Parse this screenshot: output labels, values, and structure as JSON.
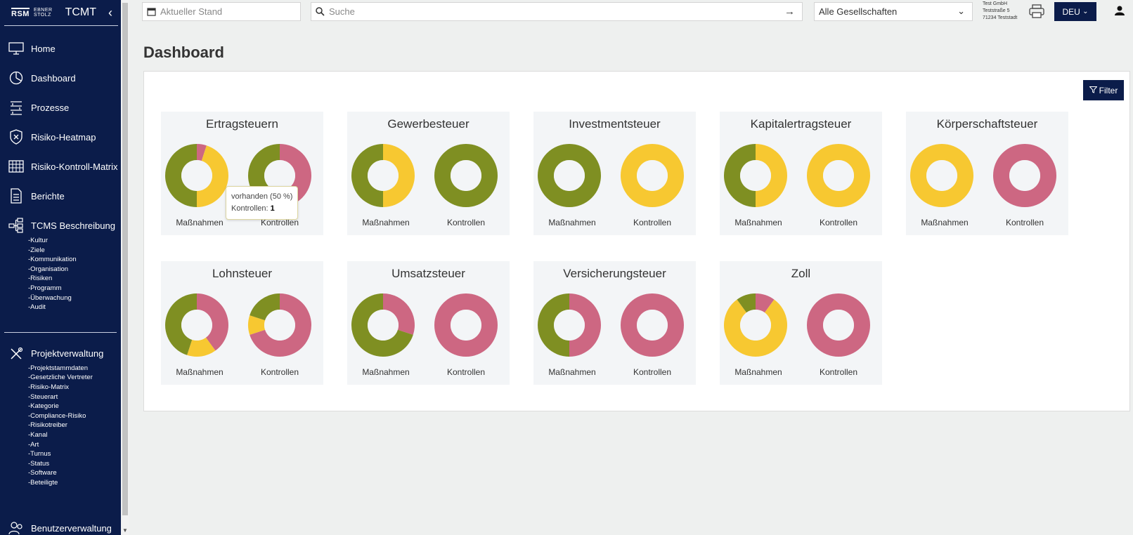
{
  "app": {
    "logo_main": "RSM",
    "logo_line1": "EBNER",
    "logo_line2": "STOLZ",
    "name": "TCMT"
  },
  "sidebar": {
    "items": [
      {
        "label": "Home",
        "icon": "monitor-icon"
      },
      {
        "label": "Dashboard",
        "icon": "pie-chart-icon"
      },
      {
        "label": "Prozesse",
        "icon": "process-icon"
      },
      {
        "label": "Risiko-Heatmap",
        "icon": "shield-icon"
      },
      {
        "label": "Risiko-Kontroll-Matrix",
        "icon": "grid-icon"
      },
      {
        "label": "Berichte",
        "icon": "report-icon"
      },
      {
        "label": "TCMS Beschreibung",
        "icon": "hierarchy-icon"
      }
    ],
    "tcms_subs": [
      "-Kultur",
      "-Ziele",
      "-Kommunikation",
      "-Organisation",
      "-Risiken",
      "-Programm",
      "-Überwachung",
      "-Audit"
    ],
    "projekt": {
      "label": "Projektverwaltung",
      "icon": "tools-icon"
    },
    "projekt_subs": [
      "-Projektstammdaten",
      "-Gesetzliche Vertreter",
      "-Risiko-Matrix",
      "-Steuerart",
      "-Kategorie",
      "-Compliance-Risiko",
      "-Risikotreiber",
      "-Kanal",
      "-Art",
      "-Turnus",
      "-Status",
      "-Software",
      "-Beteiligte"
    ],
    "benutzer": {
      "label": "Benutzerverwaltung",
      "icon": "users-icon"
    }
  },
  "topbar": {
    "date_placeholder": "Aktueller Stand",
    "search_placeholder": "Suche",
    "company_select": "Alle Gesellschaften",
    "company_lines": [
      "Test GmbH",
      "Teststraße 5",
      "71234 Teststadt"
    ],
    "language": "DEU"
  },
  "page": {
    "title": "Dashboard",
    "filter_label": "Filter"
  },
  "colors": {
    "green": "#7f8f22",
    "yellow": "#f7c831",
    "pink": "#cd6782",
    "navy": "#0b1c4a"
  },
  "chart_data": {
    "type": "pie",
    "donut_labels": [
      "Maßnahmen",
      "Kontrollen"
    ],
    "cards": [
      {
        "title": "Ertragsteuern",
        "massnahmen": {
          "green": 50,
          "yellow": 45,
          "pink": 5
        },
        "kontrollen": {
          "green": 50,
          "yellow": 0,
          "pink": 50
        }
      },
      {
        "title": "Gewerbesteuer",
        "massnahmen": {
          "green": 50,
          "yellow": 50,
          "pink": 0
        },
        "kontrollen": {
          "green": 100,
          "yellow": 0,
          "pink": 0
        }
      },
      {
        "title": "Investmentsteuer",
        "massnahmen": {
          "green": 100,
          "yellow": 0,
          "pink": 0
        },
        "kontrollen": {
          "green": 0,
          "yellow": 100,
          "pink": 0
        }
      },
      {
        "title": "Kapitalertragsteuer",
        "massnahmen": {
          "green": 50,
          "yellow": 50,
          "pink": 0
        },
        "kontrollen": {
          "green": 0,
          "yellow": 100,
          "pink": 0
        }
      },
      {
        "title": "Körperschaftsteuer",
        "massnahmen": {
          "green": 0,
          "yellow": 100,
          "pink": 0
        },
        "kontrollen": {
          "green": 0,
          "yellow": 0,
          "pink": 100
        }
      },
      {
        "title": "Lohnsteuer",
        "massnahmen": {
          "green": 45,
          "yellow": 15,
          "pink": 40
        },
        "kontrollen": {
          "green": 20,
          "yellow": 10,
          "pink": 70
        }
      },
      {
        "title": "Umsatzsteuer",
        "massnahmen": {
          "green": 70,
          "yellow": 0,
          "pink": 30
        },
        "kontrollen": {
          "green": 0,
          "yellow": 0,
          "pink": 100
        }
      },
      {
        "title": "Versicherungsteuer",
        "massnahmen": {
          "green": 50,
          "yellow": 0,
          "pink": 50
        },
        "kontrollen": {
          "green": 0,
          "yellow": 0,
          "pink": 100
        }
      },
      {
        "title": "Zoll",
        "massnahmen": {
          "green": 10,
          "yellow": 80,
          "pink": 10
        },
        "kontrollen": {
          "green": 0,
          "yellow": 0,
          "pink": 100
        }
      }
    ],
    "tooltip": {
      "line1": "vorhanden (50 %)",
      "label": "Kontrollen:",
      "value": "1"
    }
  }
}
